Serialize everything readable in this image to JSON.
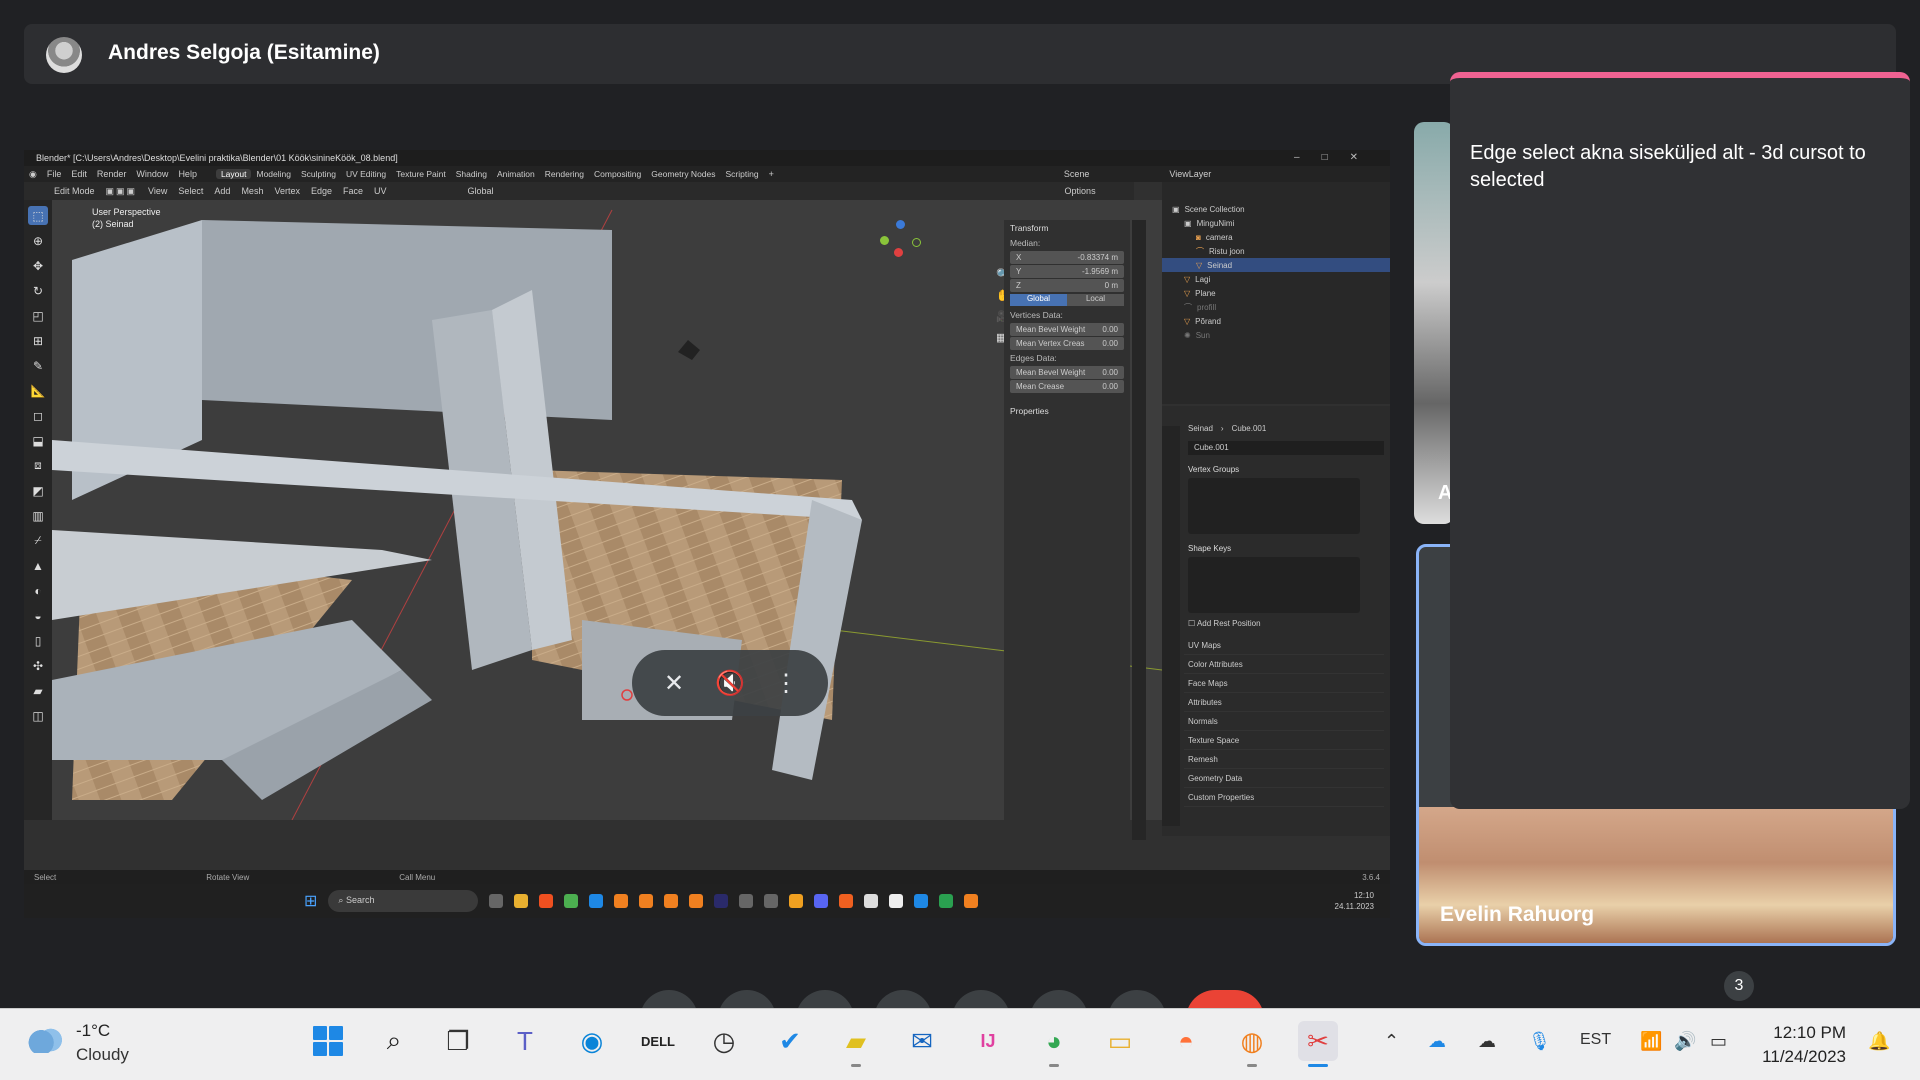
{
  "presenter": {
    "name": "Andres Selgoja (Esitamine)"
  },
  "blender": {
    "title": "Blender* [C:\\Users\\Andres\\Desktop\\Evelini praktika\\Blender\\01 Köök\\sinineKöök_08.blend]",
    "menus": [
      "File",
      "Edit",
      "Render",
      "Window",
      "Help"
    ],
    "workspaces": [
      "Layout",
      "Modeling",
      "Sculpting",
      "UV Editing",
      "Texture Paint",
      "Shading",
      "Animation",
      "Rendering",
      "Compositing",
      "Geometry Nodes",
      "Scripting"
    ],
    "active_workspace": "Layout",
    "scene_label": "Scene",
    "viewlayer_label": "ViewLayer",
    "mode": "Edit Mode",
    "header_items": [
      "View",
      "Select",
      "Add",
      "Mesh",
      "Vertex",
      "Edge",
      "Face",
      "UV"
    ],
    "orientation": "Global",
    "options_label": "Options",
    "viewport_line1": "User Perspective",
    "viewport_line2": "(2) Seinad",
    "transform": {
      "header": "Transform",
      "median": "Median:",
      "x_label": "X",
      "x_value": "-0.83374 m",
      "y_label": "Y",
      "y_value": "-1.9569 m",
      "z_label": "Z",
      "z_value": "0 m",
      "global": "Global",
      "local": "Local",
      "vertices_data": "Vertices Data:",
      "mean_bevel_weight": "Mean Bevel Weight",
      "mbw_value": "0.00",
      "mean_vertex_crease": "Mean Vertex Creas",
      "mvc_value": "0.00",
      "edges_data": "Edges Data:",
      "mean_bevel_weight_e": "Mean Bevel Weight",
      "mbwe_value": "0.00",
      "mean_crease": "Mean Crease",
      "mc_value": "0.00",
      "properties": "Properties"
    },
    "outliner": {
      "root": "Scene Collection",
      "items": [
        {
          "name": "MinguNimi",
          "depth": 1
        },
        {
          "name": "camera",
          "depth": 2
        },
        {
          "name": "Ristu joon",
          "depth": 2
        },
        {
          "name": "Seinad",
          "depth": 2,
          "selected": true
        },
        {
          "name": "Lagi",
          "depth": 1
        },
        {
          "name": "Plane",
          "depth": 1
        },
        {
          "name": "profill",
          "depth": 1
        },
        {
          "name": "Põrand",
          "depth": 1
        },
        {
          "name": "Sun",
          "depth": 1
        }
      ]
    },
    "properties": {
      "breadcrumb_obj": "Seinad",
      "breadcrumb_mesh": "Cube.001",
      "mesh_name": "Cube.001",
      "vertex_groups": "Vertex Groups",
      "shape_keys": "Shape Keys",
      "add_rest_position": "Add Rest Position",
      "sections": [
        "UV Maps",
        "Color Attributes",
        "Face Maps",
        "Attributes",
        "Normals",
        "Texture Space",
        "Remesh",
        "Geometry Data",
        "Custom Properties"
      ]
    },
    "status": {
      "select": "Select",
      "rotate": "Rotate View",
      "call_menu": "Call Menu",
      "version": "3.6.4"
    },
    "inner_taskbar": {
      "search": "Search",
      "time": "12:10",
      "date": "24.11.2023"
    }
  },
  "participants": [
    {
      "name": "Evelin Rahuorg"
    },
    {
      "letter": "A"
    }
  ],
  "chat": {
    "message": "Edge select akna siseküljed alt - 3d cursot to selected"
  },
  "people_count": "3",
  "taskbar": {
    "weather_temp": "-1°C",
    "weather_desc": "Cloudy",
    "language": "EST",
    "time": "12:10 PM",
    "date": "11/24/2023"
  },
  "colors": {
    "accent": "#4772b3",
    "chat_border": "#f06292",
    "tile_border": "#8ab4f8"
  }
}
